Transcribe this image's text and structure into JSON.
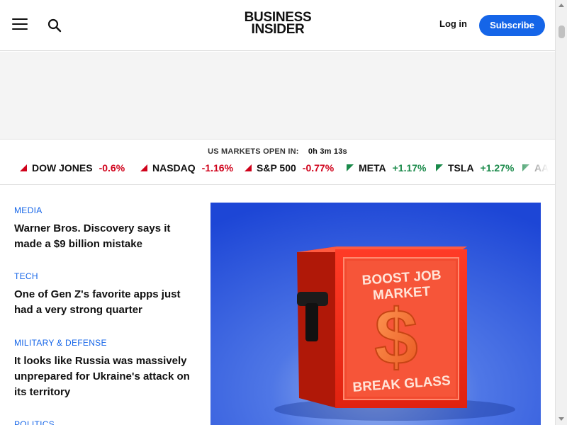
{
  "header": {
    "logo_line1": "BUSINESS",
    "logo_line2": "INSIDER",
    "login_label": "Log in",
    "subscribe_label": "Subscribe",
    "menu_icon": "hamburger-menu-icon",
    "search_icon": "search-icon"
  },
  "market": {
    "status_label": "US MARKETS OPEN IN:",
    "countdown": "0h 3m 13s",
    "tickers": [
      {
        "name": "DOW JONES",
        "change": "-0.6%",
        "direction": "down"
      },
      {
        "name": "NASDAQ",
        "change": "-1.16%",
        "direction": "down"
      },
      {
        "name": "S&P 500",
        "change": "-0.77%",
        "direction": "down"
      },
      {
        "name": "META",
        "change": "+1.17%",
        "direction": "up"
      },
      {
        "name": "TSLA",
        "change": "+1.27%",
        "direction": "up"
      },
      {
        "name": "AA",
        "change": "",
        "direction": "up"
      }
    ],
    "colors": {
      "down": "#d0021b",
      "up": "#1a8a4a"
    }
  },
  "stories": [
    {
      "category": "MEDIA",
      "headline": "Warner Bros. Discovery says it made a $9 billion mistake"
    },
    {
      "category": "TECH",
      "headline": "One of Gen Z's favorite apps just had a very strong quarter"
    },
    {
      "category": "MILITARY & DEFENSE",
      "headline": "It looks like Russia was massively unprepared for Ukraine's attack on its territory"
    },
    {
      "category": "POLITICS",
      "headline": ""
    }
  ],
  "hero": {
    "sign_line1": "BOOST JOB",
    "sign_line2": "MARKET",
    "symbol": "$",
    "caption": "BREAK GLASS"
  },
  "colors": {
    "accent": "#1565e8",
    "hero_bg": "#1f4fd8",
    "box_red": "#e4261b"
  }
}
